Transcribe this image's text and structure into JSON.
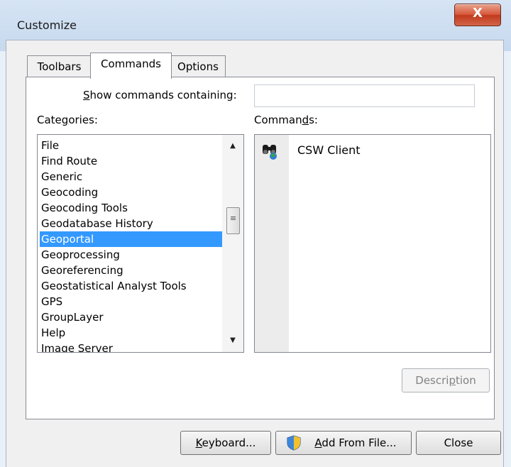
{
  "window": {
    "title": "Customize",
    "close_glyph": "X"
  },
  "tabs": [
    {
      "label": "Toolbars"
    },
    {
      "label": "Commands",
      "active": true
    },
    {
      "label": "Options"
    }
  ],
  "search": {
    "label_prefix": "S",
    "label_rest": "how commands containing:",
    "value": ""
  },
  "categories": {
    "label_start": "Cate",
    "label_u": "g",
    "label_end": "ories:",
    "items": [
      "File",
      "Find Route",
      "Generic",
      "Geocoding",
      "Geocoding Tools",
      "Geodatabase History",
      "Geoportal",
      "Geoprocessing",
      "Georeferencing",
      "Geostatistical Analyst Tools",
      "GPS",
      "GroupLayer",
      "Help",
      "Image Server"
    ],
    "selected": "Geoportal",
    "scroll_up": "▲",
    "scroll_down": "▼",
    "thumb_grip": "≡"
  },
  "commands": {
    "label_start": "Comman",
    "label_u": "d",
    "label_end": "s:",
    "items": [
      {
        "label": "CSW Client",
        "icon": "binoculars-icon"
      }
    ]
  },
  "buttons": {
    "description": {
      "start": "Descri",
      "u": "p",
      "end": "tion",
      "enabled": false
    },
    "keyboard": {
      "u": "K",
      "end": "eyboard..."
    },
    "add_from_file": {
      "u": "A",
      "end": "dd From File...",
      "icon": "uac-shield-icon"
    },
    "close": {
      "label": "Close"
    }
  },
  "colors": {
    "selection": "#3399ff",
    "close_button": "#c9462c"
  }
}
